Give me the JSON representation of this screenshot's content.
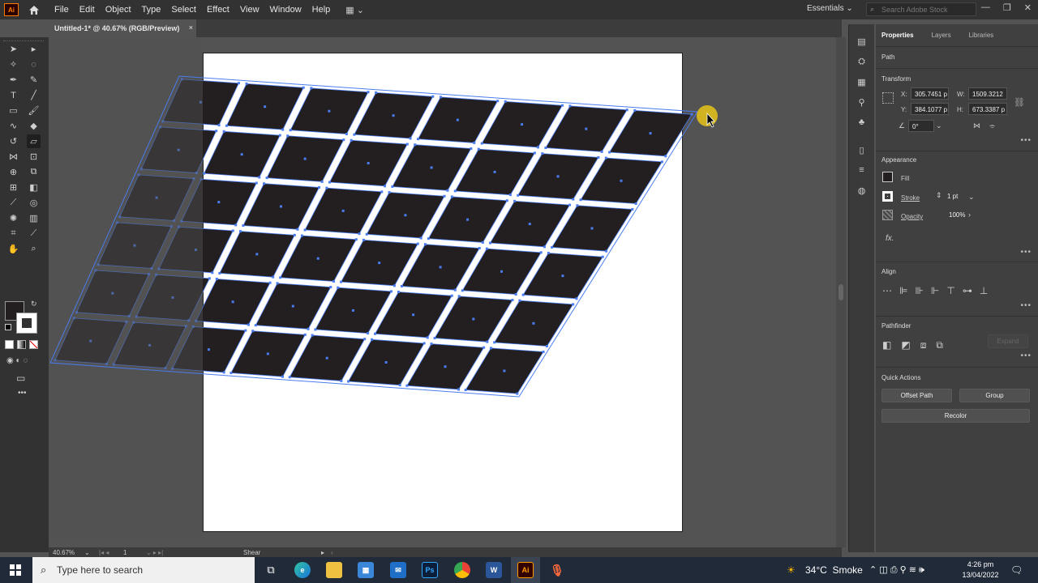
{
  "app": {
    "logo": "Ai"
  },
  "menu": {
    "items": [
      "File",
      "Edit",
      "Object",
      "Type",
      "Select",
      "Effect",
      "View",
      "Window",
      "Help"
    ],
    "workspace": "Essentials",
    "search_placeholder": "Search Adobe Stock"
  },
  "document": {
    "tab_title": "Untitled-1* @ 40.67% (RGB/Preview)",
    "close": "×"
  },
  "panel": {
    "tabs": [
      "Properties",
      "Layers",
      "Libraries"
    ],
    "selection_type": "Path",
    "transform": {
      "title": "Transform",
      "x_label": "X:",
      "x_value": "305.7451 p",
      "y_label": "Y:",
      "y_value": "384.1077 p",
      "w_label": "W:",
      "w_value": "1509.3212",
      "h_label": "H:",
      "h_value": "673.3387 p",
      "angle": "0°"
    },
    "appearance": {
      "title": "Appearance",
      "fill_label": "Fill",
      "stroke_label": "Stroke",
      "stroke_weight": "1 pt",
      "opacity_label": "Opacity",
      "opacity_value": "100%",
      "fx": "fx."
    },
    "align": {
      "title": "Align"
    },
    "pathfinder": {
      "title": "Pathfinder",
      "expand_label": "Expand"
    },
    "quick_actions": {
      "title": "Quick Actions",
      "offset_path": "Offset Path",
      "group": "Group",
      "recolor": "Recolor"
    },
    "more": "•••"
  },
  "statusbar": {
    "zoom": "40.67%",
    "artboard": "1",
    "tool": "Shear"
  },
  "taskbar": {
    "search_text": "Type here to search",
    "apps": [
      "task-view",
      "edge",
      "file-explorer",
      "store",
      "mail",
      "photoshop",
      "chrome",
      "word",
      "illustrator",
      "recorder"
    ],
    "weather": "34°C  Smoke",
    "time": "4:26 pm",
    "date": "13/04/2022"
  },
  "colors": {
    "tile": "#231f20",
    "selection": "#4a7cf0",
    "cursor_highlight": "#e8c41a",
    "illustrator_orange": "#ff7c00"
  },
  "canvas": {
    "grid_rows": 6,
    "grid_cols": 8
  }
}
